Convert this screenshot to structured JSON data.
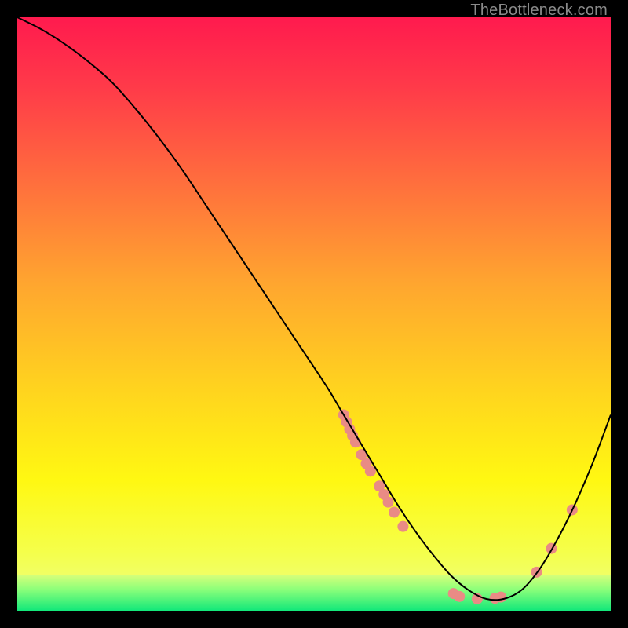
{
  "watermark": "TheBottleneck.com",
  "chart_data": {
    "type": "line",
    "title": "",
    "xlabel": "",
    "ylabel": "",
    "xlim": [
      0,
      100
    ],
    "ylim": [
      0,
      100
    ],
    "grid": false,
    "legend": false,
    "green_band": {
      "y_from": 0,
      "y_to": 6
    },
    "series": [
      {
        "name": "curve",
        "color": "#000000",
        "x": [
          0,
          4,
          8,
          12,
          16,
          20,
          24,
          28,
          32,
          36,
          40,
          44,
          48,
          52,
          55,
          58,
          61,
          64,
          67,
          70,
          73,
          76,
          79,
          82,
          85,
          88,
          91,
          94,
          97,
          100
        ],
        "y": [
          100,
          98,
          95.5,
          92.5,
          89,
          84.5,
          79.5,
          74,
          68,
          62,
          56,
          50,
          44,
          38,
          33,
          28,
          23,
          18,
          13.5,
          9.5,
          6,
          3.5,
          2,
          2,
          3.5,
          7,
          12,
          18,
          25,
          33
        ]
      }
    ],
    "scatter": [
      {
        "name": "dots",
        "color": "#e98b85",
        "radius": 7,
        "points": [
          {
            "x": 55.0,
            "y": 33.0
          },
          {
            "x": 55.5,
            "y": 31.8
          },
          {
            "x": 56.0,
            "y": 30.6
          },
          {
            "x": 56.5,
            "y": 29.5
          },
          {
            "x": 57.0,
            "y": 28.4
          },
          {
            "x": 58.0,
            "y": 26.3
          },
          {
            "x": 58.8,
            "y": 24.8
          },
          {
            "x": 59.5,
            "y": 23.5
          },
          {
            "x": 61.0,
            "y": 21.0
          },
          {
            "x": 61.8,
            "y": 19.6
          },
          {
            "x": 62.5,
            "y": 18.3
          },
          {
            "x": 63.5,
            "y": 16.6
          },
          {
            "x": 65.0,
            "y": 14.2
          },
          {
            "x": 73.5,
            "y": 2.9
          },
          {
            "x": 74.5,
            "y": 2.4
          },
          {
            "x": 77.5,
            "y": 2.0
          },
          {
            "x": 80.5,
            "y": 2.1
          },
          {
            "x": 81.5,
            "y": 2.3
          },
          {
            "x": 87.5,
            "y": 6.5
          },
          {
            "x": 90.0,
            "y": 10.5
          },
          {
            "x": 93.5,
            "y": 17.0
          }
        ]
      }
    ]
  }
}
